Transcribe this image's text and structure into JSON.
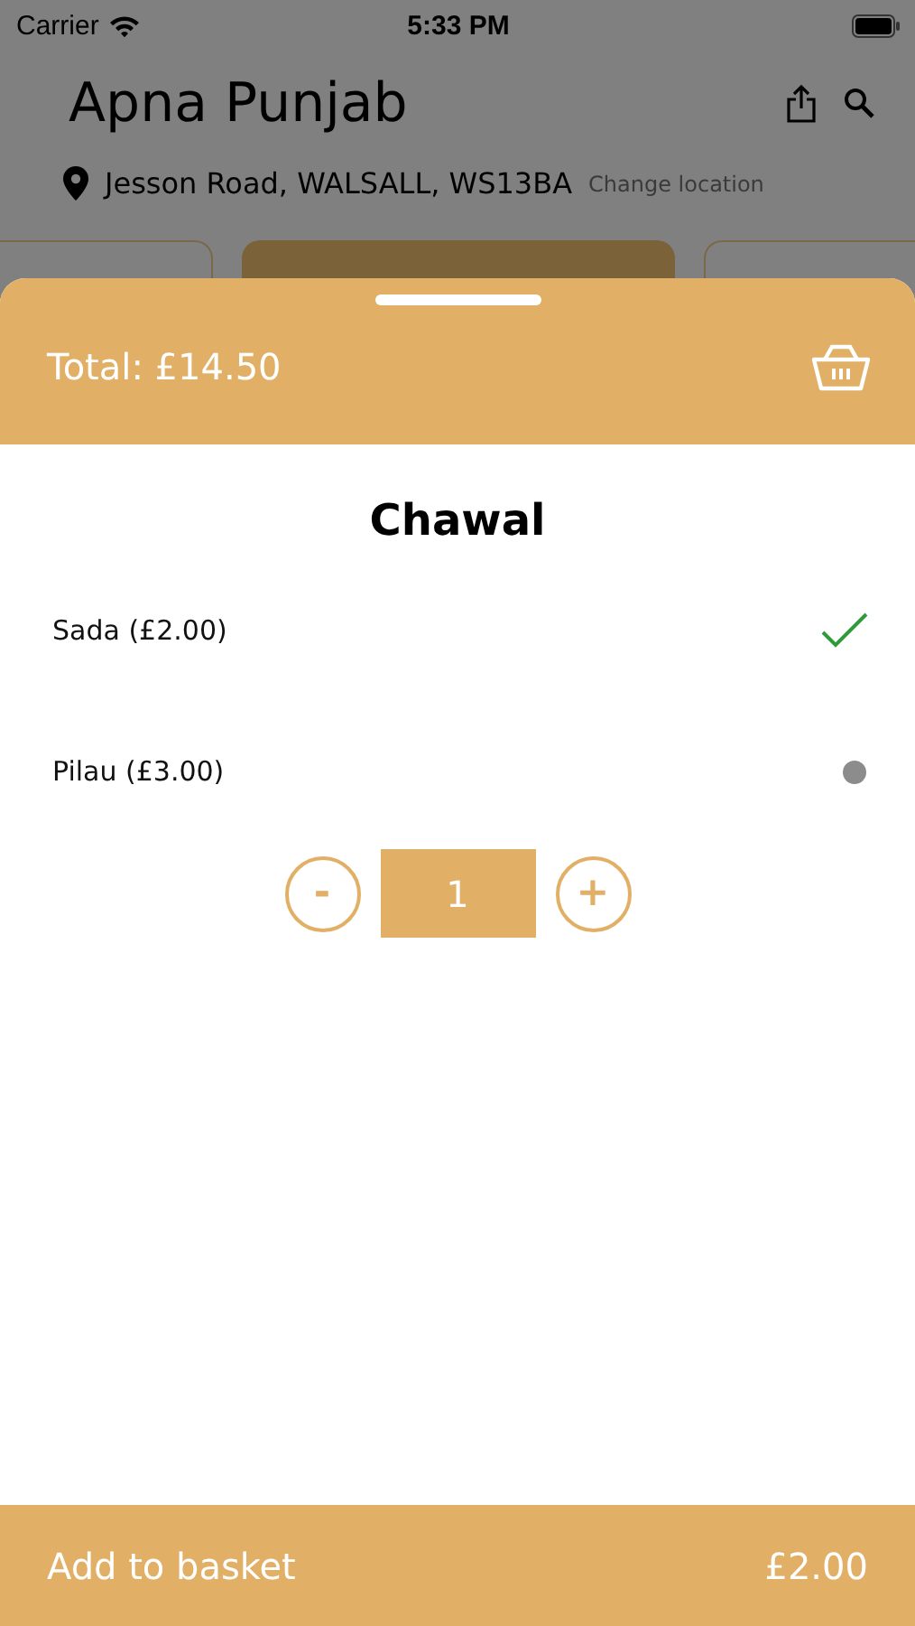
{
  "status_bar": {
    "carrier": "Carrier",
    "time": "5:33 PM"
  },
  "restaurant": {
    "name": "Apna Punjab",
    "address": "Jesson Road, WALSALL, WS13BA",
    "change_location": "Change location"
  },
  "category_tabs": [
    {
      "selected": false
    },
    {
      "selected": true
    },
    {
      "selected": false
    }
  ],
  "sheet": {
    "total": "Total: £14.50",
    "title": "Chawal",
    "options": [
      {
        "label": "Sada (£2.00)",
        "selected": true
      },
      {
        "label": "Pilau (£3.00)",
        "selected": false
      }
    ],
    "stepper": {
      "minus": "-",
      "quantity": "1",
      "plus": "+"
    },
    "add_button": {
      "label": "Add to basket",
      "price": "£2.00"
    }
  }
}
